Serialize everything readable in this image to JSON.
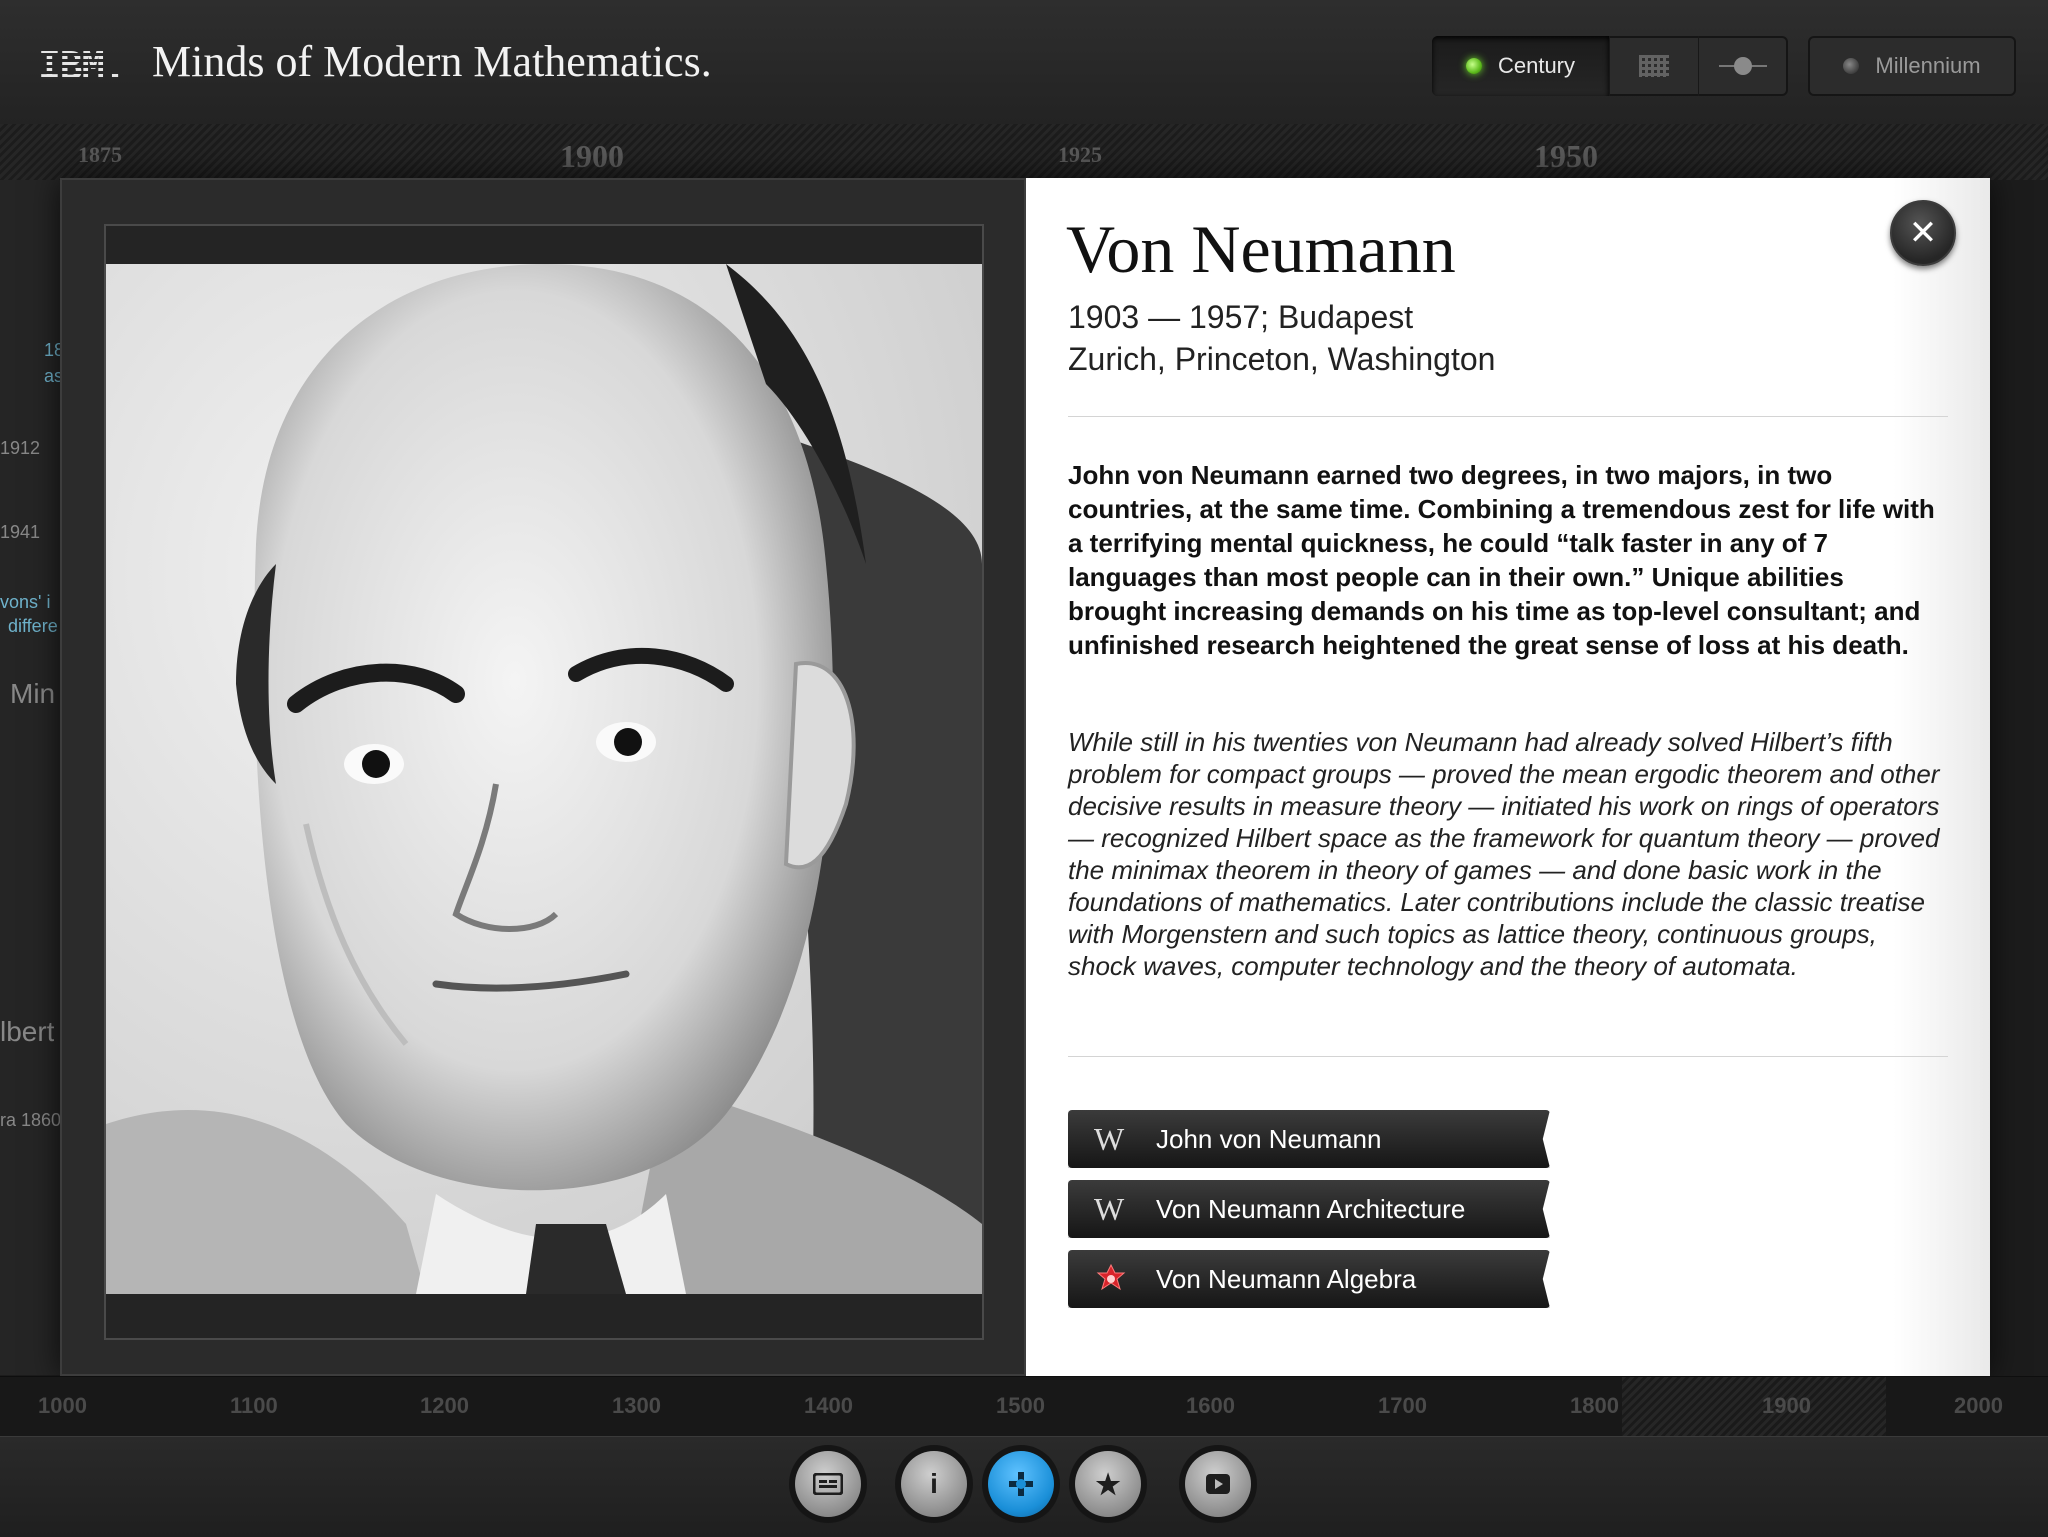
{
  "header": {
    "logo": "IBM.",
    "title": "Minds of Modern Mathematics.",
    "century_label": "Century",
    "millennium_label": "Millennium"
  },
  "timeline_top": [
    "1875",
    "1900",
    "1925",
    "1950"
  ],
  "background_list": [
    "18",
    "as",
    "1912",
    "1941",
    "vons' i",
    "differe",
    "Min",
    "lbert",
    "ra 1860"
  ],
  "person": {
    "name": "Von Neumann",
    "dates_line1": "1903 — 1957; Budapest",
    "dates_line2": "Zurich, Princeton, Washington",
    "description": "John von Neumann earned two degrees, in two majors, in two countries, at the same time. Combining a tremendous zest for life with a terrifying mental quickness, he could “talk faster in any of 7 languages than most people can in their own.” Unique abilities brought increasing demands on his time as top-level consultant; and unfinished research heightened the great sense of loss at his death.",
    "detail": "While still in his twenties von Neumann had already solved Hilbert’s fifth problem for compact groups — proved the mean ergodic theorem and other decisive results in measure theory — initiated his work on rings of operators — recognized Hilbert space as the framework for quantum theory — proved the minimax theorem in theory of games — and done basic work in the foundations of mathematics. Later contributions include the classic treatise with Morgenstern and such topics as lattice theory, continuous groups, shock waves, computer technology and the theory of automata."
  },
  "links": [
    {
      "icon": "W",
      "label": "John von Neumann"
    },
    {
      "icon": "W",
      "label": "Von Neumann Architecture"
    },
    {
      "icon": "wolfram-icon",
      "label": "Von Neumann Algebra"
    }
  ],
  "close_glyph": "✕",
  "timeline_bottom": [
    "1000",
    "1100",
    "1200",
    "1300",
    "1400",
    "1500",
    "1600",
    "1700",
    "1800",
    "1900",
    "2000"
  ],
  "toolbar": {
    "info_glyph": "i",
    "star_glyph": "★"
  },
  "colors": {
    "accent_blue": "#1a8fd8",
    "led_green": "#5dbb1c"
  }
}
